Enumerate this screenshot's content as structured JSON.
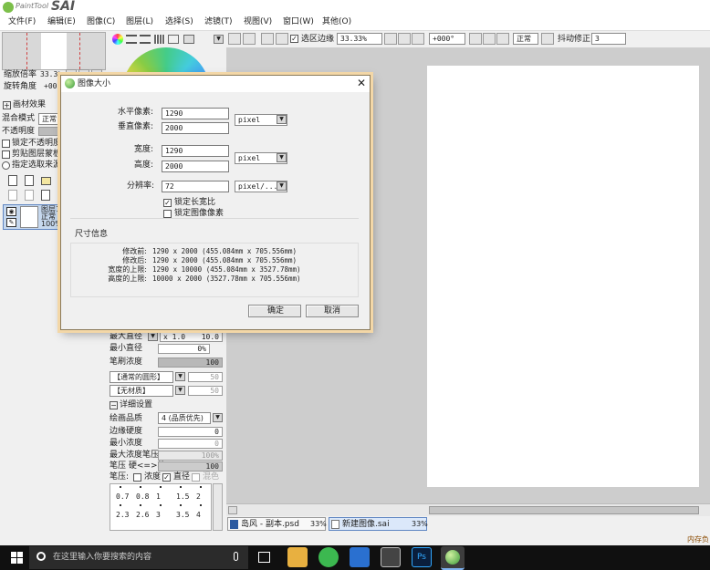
{
  "app": {
    "logo_small": "PaintTool",
    "logo_big": "SAI"
  },
  "menu": [
    "文件(F)",
    "编辑(E)",
    "图像(C)",
    "图层(L)",
    "选择(S)",
    "滤镜(T)",
    "视图(V)",
    "窗口(W)",
    "其他(O)"
  ],
  "toolbar": {
    "selection_edge_label": "选区边缘",
    "zoom": "33.33%",
    "rotation": "+000°",
    "blend_mode": "正常",
    "stabilizer_label": "抖动修正",
    "stabilizer_value": "3"
  },
  "navigator": {
    "zoom_label": "缩放倍率",
    "zoom_value": "33.3%",
    "rotate_label": "旋转角度",
    "rotate_value": "+000"
  },
  "layer_panel": {
    "effects_label": "画材效果",
    "blend_label": "混合模式",
    "blend_value": "正常",
    "opacity_label": "不透明度",
    "checks": [
      "锁定不透明度",
      "剪贴图层蒙板",
      "指定选取来源"
    ],
    "layer_name": "图层1",
    "layer_mode": "正常",
    "layer_opacity": "100%"
  },
  "brush_panel": {
    "max_size_label": "最大直径",
    "max_size_mult": "x 1.0",
    "max_size_value": "10.0",
    "min_size_label": "最小直径",
    "min_size_value": "0%",
    "density_label": "笔刷浓度",
    "density_value": "100",
    "shape_value": "【通常的圆形】",
    "shape_num": "50",
    "texture_value": "【无材质】",
    "texture_num": "50",
    "detail_label": "详细设置",
    "quality_label": "绘画品质",
    "quality_value": "4 (品质优先)",
    "edge_label": "边缘硬度",
    "edge_value": "0",
    "min_density_label": "最小浓度",
    "min_density_value": "0",
    "max_pressure_label": "最大浓度笔压",
    "max_pressure_value": "100%",
    "pressure_label": "笔压 硬<=>软",
    "pressure_value": "100",
    "pressure_opts_label": "笔压:",
    "pressure_opts": [
      "浓度",
      "直径",
      "混色"
    ],
    "presets_row1": [
      "0.7",
      "0.8",
      "1",
      "1.5",
      "2"
    ],
    "presets_row2": [
      "2.3",
      "2.6",
      "3",
      "3.5",
      "4"
    ]
  },
  "dialog": {
    "title": "图像大小",
    "h_pixels_label": "水平像素:",
    "h_pixels_value": "1290",
    "v_pixels_label": "垂直像素:",
    "v_pixels_value": "2000",
    "pixel_unit": "pixel",
    "width_label": "宽度:",
    "width_value": "1290",
    "height_label": "高度:",
    "height_value": "2000",
    "size_unit": "pixel",
    "resolution_label": "分辨率:",
    "resolution_value": "72",
    "resolution_unit": "pixel/...",
    "lock_ratio_label": "锁定长宽比",
    "lock_pixels_label": "锁定图像像素",
    "info_title": "尺寸信息",
    "info_rows": [
      {
        "label": "修改前:",
        "value": "1290 x 2000 (455.084mm x 705.556mm)"
      },
      {
        "label": "修改后:",
        "value": "1290 x 2000 (455.084mm x 705.556mm)"
      },
      {
        "label": "宽度的上限:",
        "value": "1290 x 10000 (455.084mm x 3527.78mm)"
      },
      {
        "label": "高度的上限:",
        "value": "10000 x 2000 (3527.78mm x 705.556mm)"
      }
    ],
    "ok_label": "确定",
    "cancel_label": "取消"
  },
  "doc_tabs": [
    {
      "name": "岛风 - 副本.psd",
      "zoom": "33%"
    },
    {
      "name": "新建图像.sai",
      "zoom": "33%"
    }
  ],
  "status": {
    "memory": "内存负"
  },
  "taskbar": {
    "search_placeholder": "在这里输入你要搜索的内容"
  }
}
